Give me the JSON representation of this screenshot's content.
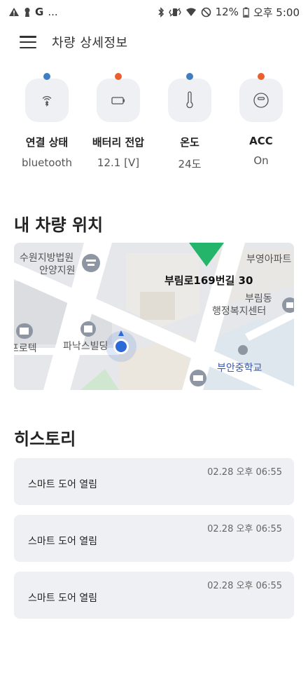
{
  "status_bar": {
    "left_icons": [
      "warning-icon",
      "keyhole-icon"
    ],
    "app_letter": "G",
    "more": "...",
    "right_icons": [
      "bluetooth-icon",
      "vibrate-icon",
      "wifi-icon",
      "do-not-disturb-icon",
      "battery-icon"
    ],
    "battery": "12%",
    "time": "오후 5:00"
  },
  "header": {
    "menu_icon": "hamburger-menu-icon",
    "title": "차량 상세정보"
  },
  "vehicle_status": [
    {
      "label": "연결 상태",
      "value": "bluetooth",
      "icon": "bluetooth-signal-icon",
      "indicator_color": "#3f7ec0"
    },
    {
      "label": "배터리 전압",
      "value": "12.1 [V]",
      "icon": "battery-icon",
      "indicator_color": "#e8612c"
    },
    {
      "label": "온도",
      "value": "24도",
      "icon": "thermometer-icon",
      "indicator_color": "#3f7ec0"
    },
    {
      "label": "ACC",
      "value": "On",
      "icon": "acc-icon",
      "indicator_color": "#e8612c"
    }
  ],
  "location": {
    "title": "내 차량 위치",
    "map_labels": {
      "court": "수원지방법원",
      "court2": "안양지원",
      "apt": "부영아파트",
      "address": "부림로169번길 30",
      "office": "부림동",
      "office2": "행정복지센터",
      "building": "파낙스빌딩",
      "left": "프로텍",
      "school": "부안중학교"
    }
  },
  "history": {
    "title": "히스토리",
    "items": [
      {
        "time": "02.28 오후 06:55",
        "event": "스마트 도어 열림"
      },
      {
        "time": "02.28 오후 06:55",
        "event": "스마트 도어 열림"
      },
      {
        "time": "02.28 오후 06:55",
        "event": "스마트 도어 열림"
      }
    ]
  }
}
